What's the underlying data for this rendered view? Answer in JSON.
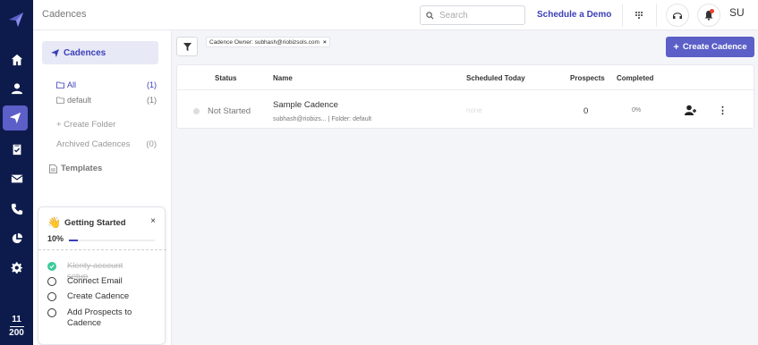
{
  "rail": {
    "counter_top": "11",
    "counter_bottom": "200",
    "items": [
      "home",
      "contacts",
      "cadences",
      "tasks",
      "email",
      "calls",
      "reports",
      "settings"
    ]
  },
  "topbar": {
    "title": "Cadences",
    "search_placeholder": "Search",
    "schedule_demo": "Schedule a Demo",
    "avatar_initials": "SU"
  },
  "sidebar": {
    "cadences_label": "Cadences",
    "folders": [
      {
        "label": "All",
        "count": "(1)"
      },
      {
        "label": "default",
        "count": "(1)"
      }
    ],
    "create_folder": "+ Create Folder",
    "archived_label": "Archived Cadences",
    "archived_count": "(0)",
    "templates_label": "Templates"
  },
  "getting_started": {
    "title": "Getting Started",
    "close": "×",
    "progress_label": "10%",
    "progress_fraction": 0.1,
    "tasks": [
      {
        "label": "Klenty account setup",
        "done": true
      },
      {
        "label": "Connect Email",
        "done": false
      },
      {
        "label": "Create Cadence",
        "done": false
      },
      {
        "label": "Add Prospects to Cadence",
        "done": false
      }
    ]
  },
  "filter": {
    "chip_text": "Cadence Owner: subhash@riobizsols.com",
    "chip_close": "×"
  },
  "create_cadence_label": "Create Cadence",
  "table": {
    "headers": {
      "status": "Status",
      "name": "Name",
      "scheduled": "Scheduled Today",
      "prospects": "Prospects",
      "completed": "Completed"
    },
    "rows": [
      {
        "status": "Not Started",
        "name": "Sample Cadence",
        "sub": "subhash@riobizs... | Folder: default",
        "scheduled": "none",
        "prospects": "0",
        "completed": "0%"
      }
    ]
  },
  "colors": {
    "rail_bg": "#0d1b4c",
    "accent": "#5b5fc7",
    "accent_text": "#3b3fb8",
    "success": "#3cc99b"
  }
}
